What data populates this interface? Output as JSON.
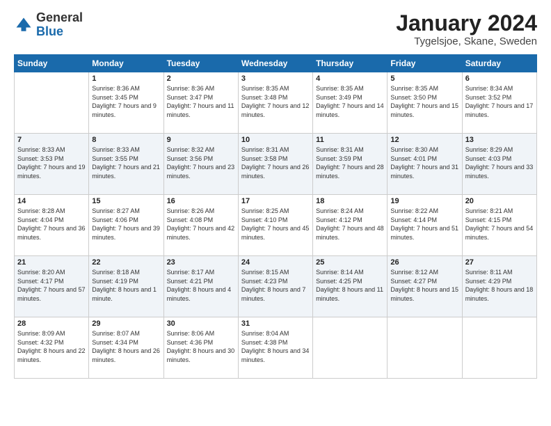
{
  "logo": {
    "general": "General",
    "blue": "Blue"
  },
  "title": "January 2024",
  "subtitle": "Tygelsjoe, Skane, Sweden",
  "days_of_week": [
    "Sunday",
    "Monday",
    "Tuesday",
    "Wednesday",
    "Thursday",
    "Friday",
    "Saturday"
  ],
  "weeks": [
    [
      {
        "day": "",
        "sunrise": "",
        "sunset": "",
        "daylight": ""
      },
      {
        "day": "1",
        "sunrise": "Sunrise: 8:36 AM",
        "sunset": "Sunset: 3:45 PM",
        "daylight": "Daylight: 7 hours and 9 minutes."
      },
      {
        "day": "2",
        "sunrise": "Sunrise: 8:36 AM",
        "sunset": "Sunset: 3:47 PM",
        "daylight": "Daylight: 7 hours and 11 minutes."
      },
      {
        "day": "3",
        "sunrise": "Sunrise: 8:35 AM",
        "sunset": "Sunset: 3:48 PM",
        "daylight": "Daylight: 7 hours and 12 minutes."
      },
      {
        "day": "4",
        "sunrise": "Sunrise: 8:35 AM",
        "sunset": "Sunset: 3:49 PM",
        "daylight": "Daylight: 7 hours and 14 minutes."
      },
      {
        "day": "5",
        "sunrise": "Sunrise: 8:35 AM",
        "sunset": "Sunset: 3:50 PM",
        "daylight": "Daylight: 7 hours and 15 minutes."
      },
      {
        "day": "6",
        "sunrise": "Sunrise: 8:34 AM",
        "sunset": "Sunset: 3:52 PM",
        "daylight": "Daylight: 7 hours and 17 minutes."
      }
    ],
    [
      {
        "day": "7",
        "sunrise": "Sunrise: 8:33 AM",
        "sunset": "Sunset: 3:53 PM",
        "daylight": "Daylight: 7 hours and 19 minutes."
      },
      {
        "day": "8",
        "sunrise": "Sunrise: 8:33 AM",
        "sunset": "Sunset: 3:55 PM",
        "daylight": "Daylight: 7 hours and 21 minutes."
      },
      {
        "day": "9",
        "sunrise": "Sunrise: 8:32 AM",
        "sunset": "Sunset: 3:56 PM",
        "daylight": "Daylight: 7 hours and 23 minutes."
      },
      {
        "day": "10",
        "sunrise": "Sunrise: 8:31 AM",
        "sunset": "Sunset: 3:58 PM",
        "daylight": "Daylight: 7 hours and 26 minutes."
      },
      {
        "day": "11",
        "sunrise": "Sunrise: 8:31 AM",
        "sunset": "Sunset: 3:59 PM",
        "daylight": "Daylight: 7 hours and 28 minutes."
      },
      {
        "day": "12",
        "sunrise": "Sunrise: 8:30 AM",
        "sunset": "Sunset: 4:01 PM",
        "daylight": "Daylight: 7 hours and 31 minutes."
      },
      {
        "day": "13",
        "sunrise": "Sunrise: 8:29 AM",
        "sunset": "Sunset: 4:03 PM",
        "daylight": "Daylight: 7 hours and 33 minutes."
      }
    ],
    [
      {
        "day": "14",
        "sunrise": "Sunrise: 8:28 AM",
        "sunset": "Sunset: 4:04 PM",
        "daylight": "Daylight: 7 hours and 36 minutes."
      },
      {
        "day": "15",
        "sunrise": "Sunrise: 8:27 AM",
        "sunset": "Sunset: 4:06 PM",
        "daylight": "Daylight: 7 hours and 39 minutes."
      },
      {
        "day": "16",
        "sunrise": "Sunrise: 8:26 AM",
        "sunset": "Sunset: 4:08 PM",
        "daylight": "Daylight: 7 hours and 42 minutes."
      },
      {
        "day": "17",
        "sunrise": "Sunrise: 8:25 AM",
        "sunset": "Sunset: 4:10 PM",
        "daylight": "Daylight: 7 hours and 45 minutes."
      },
      {
        "day": "18",
        "sunrise": "Sunrise: 8:24 AM",
        "sunset": "Sunset: 4:12 PM",
        "daylight": "Daylight: 7 hours and 48 minutes."
      },
      {
        "day": "19",
        "sunrise": "Sunrise: 8:22 AM",
        "sunset": "Sunset: 4:14 PM",
        "daylight": "Daylight: 7 hours and 51 minutes."
      },
      {
        "day": "20",
        "sunrise": "Sunrise: 8:21 AM",
        "sunset": "Sunset: 4:15 PM",
        "daylight": "Daylight: 7 hours and 54 minutes."
      }
    ],
    [
      {
        "day": "21",
        "sunrise": "Sunrise: 8:20 AM",
        "sunset": "Sunset: 4:17 PM",
        "daylight": "Daylight: 7 hours and 57 minutes."
      },
      {
        "day": "22",
        "sunrise": "Sunrise: 8:18 AM",
        "sunset": "Sunset: 4:19 PM",
        "daylight": "Daylight: 8 hours and 1 minute."
      },
      {
        "day": "23",
        "sunrise": "Sunrise: 8:17 AM",
        "sunset": "Sunset: 4:21 PM",
        "daylight": "Daylight: 8 hours and 4 minutes."
      },
      {
        "day": "24",
        "sunrise": "Sunrise: 8:15 AM",
        "sunset": "Sunset: 4:23 PM",
        "daylight": "Daylight: 8 hours and 7 minutes."
      },
      {
        "day": "25",
        "sunrise": "Sunrise: 8:14 AM",
        "sunset": "Sunset: 4:25 PM",
        "daylight": "Daylight: 8 hours and 11 minutes."
      },
      {
        "day": "26",
        "sunrise": "Sunrise: 8:12 AM",
        "sunset": "Sunset: 4:27 PM",
        "daylight": "Daylight: 8 hours and 15 minutes."
      },
      {
        "day": "27",
        "sunrise": "Sunrise: 8:11 AM",
        "sunset": "Sunset: 4:29 PM",
        "daylight": "Daylight: 8 hours and 18 minutes."
      }
    ],
    [
      {
        "day": "28",
        "sunrise": "Sunrise: 8:09 AM",
        "sunset": "Sunset: 4:32 PM",
        "daylight": "Daylight: 8 hours and 22 minutes."
      },
      {
        "day": "29",
        "sunrise": "Sunrise: 8:07 AM",
        "sunset": "Sunset: 4:34 PM",
        "daylight": "Daylight: 8 hours and 26 minutes."
      },
      {
        "day": "30",
        "sunrise": "Sunrise: 8:06 AM",
        "sunset": "Sunset: 4:36 PM",
        "daylight": "Daylight: 8 hours and 30 minutes."
      },
      {
        "day": "31",
        "sunrise": "Sunrise: 8:04 AM",
        "sunset": "Sunset: 4:38 PM",
        "daylight": "Daylight: 8 hours and 34 minutes."
      },
      {
        "day": "",
        "sunrise": "",
        "sunset": "",
        "daylight": ""
      },
      {
        "day": "",
        "sunrise": "",
        "sunset": "",
        "daylight": ""
      },
      {
        "day": "",
        "sunrise": "",
        "sunset": "",
        "daylight": ""
      }
    ]
  ]
}
